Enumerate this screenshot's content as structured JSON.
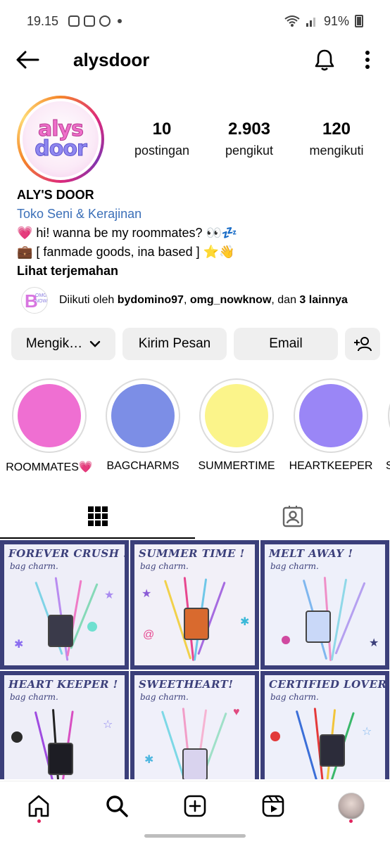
{
  "status_bar": {
    "time": "19.15",
    "battery": "91%"
  },
  "header": {
    "username": "alysdoor"
  },
  "profile": {
    "avatar_line1": "alys",
    "avatar_line2": "door",
    "stats": [
      {
        "value": "10",
        "label": "postingan"
      },
      {
        "value": "2.903",
        "label": "pengikut"
      },
      {
        "value": "120",
        "label": "mengikuti"
      }
    ],
    "name": "ALY'S DOOR",
    "category": "Toko Seni & Kerajinan",
    "bio_line1": "💗 hi! wanna be my roommates? 👀💤",
    "bio_line2": "💼 [ fanmade goods, ina based ] ⭐👋",
    "see_translation": "Lihat terjemahan",
    "followed_prefix": "Diikuti oleh ",
    "followed_user1": "bydomino97",
    "followed_sep": ", ",
    "followed_user2": "omg_nowknow",
    "followed_mid": ", dan ",
    "followed_more": "3 lainnya"
  },
  "buttons": {
    "following": "Mengik…",
    "message": "Kirim Pesan",
    "email": "Email"
  },
  "highlights": [
    {
      "label": "ROOMMATES💗",
      "color": "#ef6fd2"
    },
    {
      "label": "BAGCHARMS",
      "color": "#7c8ee6"
    },
    {
      "label": "SUMMERTIME",
      "color": "#fbf48a"
    },
    {
      "label": "HEARTKEEPER",
      "color": "#9a86f6"
    },
    {
      "label": "S",
      "color": "#f0f0f0"
    }
  ],
  "posts": [
    {
      "title": "FOREVER CRUSH !",
      "subtitle": "bag charm."
    },
    {
      "title": "SUMMER TIME !",
      "subtitle": "bag charm."
    },
    {
      "title": "MELT AWAY !",
      "subtitle": "bag charm."
    },
    {
      "title": "HEART KEEPER !",
      "subtitle": "bag charm."
    },
    {
      "title": "SWEETHEART!",
      "subtitle": "bag charm."
    },
    {
      "title": "CERTIFIED LOVER !",
      "subtitle": "bag charm."
    }
  ],
  "colors": {
    "link": "#3b6fb8",
    "post_border": "#3b3f7a",
    "button_bg": "#efefef"
  },
  "icons": [
    "back-arrow-icon",
    "bell-icon",
    "more-vertical-icon",
    "chevron-down-icon",
    "add-person-icon",
    "grid-icon",
    "tagged-icon",
    "home-icon",
    "search-icon",
    "create-icon",
    "reels-icon"
  ]
}
